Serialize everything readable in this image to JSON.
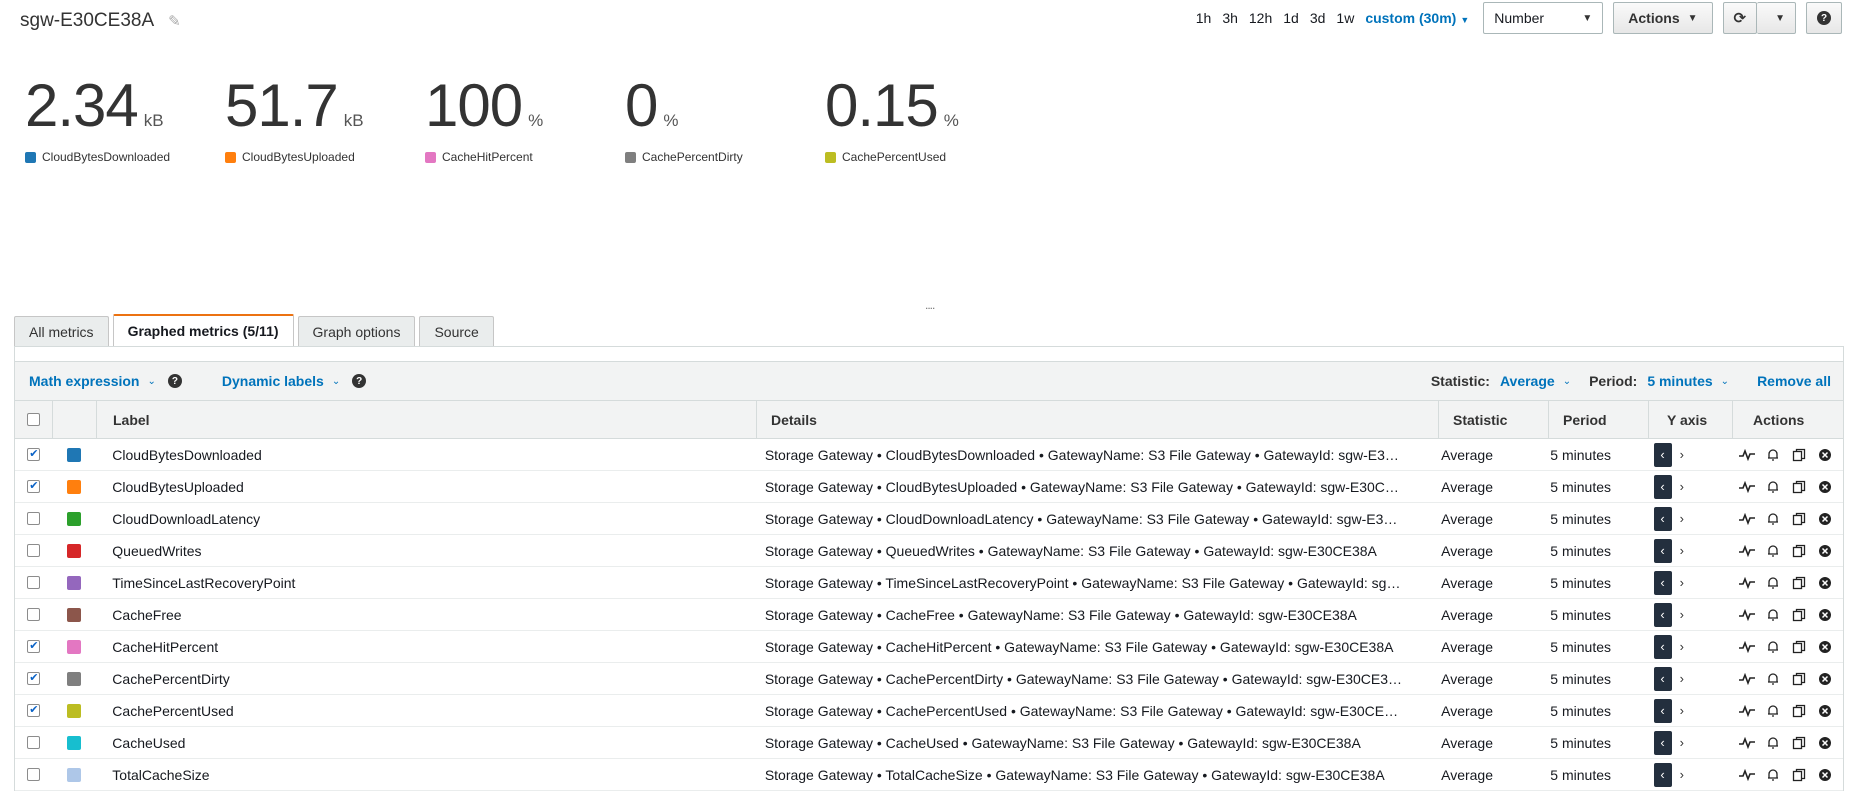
{
  "header": {
    "title": "sgw-E30CE38A",
    "ranges": [
      "1h",
      "3h",
      "12h",
      "1d",
      "3d",
      "1w"
    ],
    "custom_range": "custom (30m)",
    "format_select": "Number",
    "actions_label": "Actions"
  },
  "stats": [
    {
      "value": "2.34",
      "unit": "kB",
      "name": "CloudBytesDownloaded",
      "color": "#1f77b4"
    },
    {
      "value": "51.7",
      "unit": "kB",
      "name": "CloudBytesUploaded",
      "color": "#ff7f0e"
    },
    {
      "value": "100",
      "unit": "%",
      "name": "CacheHitPercent",
      "color": "#e377c2"
    },
    {
      "value": "0",
      "unit": "%",
      "name": "CachePercentDirty",
      "color": "#7f7f7f"
    },
    {
      "value": "0.15",
      "unit": "%",
      "name": "CachePercentUsed",
      "color": "#bcbd22"
    }
  ],
  "resize_handle": "....",
  "tabs": [
    "All metrics",
    "Graphed metrics (5/11)",
    "Graph options",
    "Source"
  ],
  "filterbar": {
    "math_expression": "Math expression",
    "dynamic_labels": "Dynamic labels",
    "statistic_label": "Statistic:",
    "statistic_value": "Average",
    "period_label": "Period:",
    "period_value": "5 minutes",
    "remove_all": "Remove all"
  },
  "table": {
    "headers": {
      "label": "Label",
      "details": "Details",
      "statistic": "Statistic",
      "period": "Period",
      "yaxis": "Y axis",
      "actions": "Actions"
    },
    "rows": [
      {
        "checked": true,
        "color": "#1f77b4",
        "label": "CloudBytesDownloaded",
        "details": "Storage Gateway • CloudBytesDownloaded • GatewayName: S3 File Gateway • GatewayId: sgw-E3…",
        "statistic": "Average",
        "period": "5 minutes"
      },
      {
        "checked": true,
        "color": "#ff7f0e",
        "label": "CloudBytesUploaded",
        "details": "Storage Gateway • CloudBytesUploaded • GatewayName: S3 File Gateway • GatewayId: sgw-E30C…",
        "statistic": "Average",
        "period": "5 minutes"
      },
      {
        "checked": false,
        "color": "#2ca02c",
        "label": "CloudDownloadLatency",
        "details": "Storage Gateway • CloudDownloadLatency • GatewayName: S3 File Gateway • GatewayId: sgw-E3…",
        "statistic": "Average",
        "period": "5 minutes"
      },
      {
        "checked": false,
        "color": "#d62728",
        "label": "QueuedWrites",
        "details": "Storage Gateway • QueuedWrites • GatewayName: S3 File Gateway • GatewayId: sgw-E30CE38A",
        "statistic": "Average",
        "period": "5 minutes"
      },
      {
        "checked": false,
        "color": "#9467bd",
        "label": "TimeSinceLastRecoveryPoint",
        "details": "Storage Gateway • TimeSinceLastRecoveryPoint • GatewayName: S3 File Gateway • GatewayId: sg…",
        "statistic": "Average",
        "period": "5 minutes"
      },
      {
        "checked": false,
        "color": "#8c564b",
        "label": "CacheFree",
        "details": "Storage Gateway • CacheFree • GatewayName: S3 File Gateway • GatewayId: sgw-E30CE38A",
        "statistic": "Average",
        "period": "5 minutes"
      },
      {
        "checked": true,
        "color": "#e377c2",
        "label": "CacheHitPercent",
        "details": "Storage Gateway • CacheHitPercent • GatewayName: S3 File Gateway • GatewayId: sgw-E30CE38A",
        "statistic": "Average",
        "period": "5 minutes"
      },
      {
        "checked": true,
        "color": "#7f7f7f",
        "label": "CachePercentDirty",
        "details": "Storage Gateway • CachePercentDirty • GatewayName: S3 File Gateway • GatewayId: sgw-E30CE3…",
        "statistic": "Average",
        "period": "5 minutes"
      },
      {
        "checked": true,
        "color": "#bcbd22",
        "label": "CachePercentUsed",
        "details": "Storage Gateway • CachePercentUsed • GatewayName: S3 File Gateway • GatewayId: sgw-E30CE…",
        "statistic": "Average",
        "period": "5 minutes"
      },
      {
        "checked": false,
        "color": "#17becf",
        "label": "CacheUsed",
        "details": "Storage Gateway • CacheUsed • GatewayName: S3 File Gateway • GatewayId: sgw-E30CE38A",
        "statistic": "Average",
        "period": "5 minutes"
      },
      {
        "checked": false,
        "color": "#aec7e8",
        "label": "TotalCacheSize",
        "details": "Storage Gateway • TotalCacheSize • GatewayName: S3 File Gateway • GatewayId: sgw-E30CE38A",
        "statistic": "Average",
        "period": "5 minutes"
      }
    ]
  }
}
